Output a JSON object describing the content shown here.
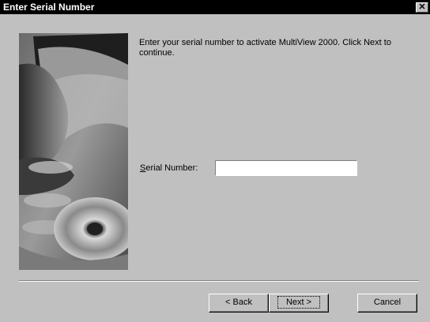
{
  "window": {
    "title": "Enter Serial Number",
    "close_glyph": "✕"
  },
  "main": {
    "instructions": "Enter your serial number to activate MultiView 2000. Click Next to continue.",
    "serial_label": "Serial Number:",
    "serial_value": "",
    "serial_placeholder": ""
  },
  "buttons": {
    "back": "< Back",
    "next": "Next >",
    "cancel": "Cancel"
  },
  "icons": {
    "close": "close-icon",
    "side_image": "cd-disc-hand-image"
  },
  "colors": {
    "titlebar": "#000000",
    "face": "#c0c0c0",
    "input_bg": "#ffffff"
  }
}
